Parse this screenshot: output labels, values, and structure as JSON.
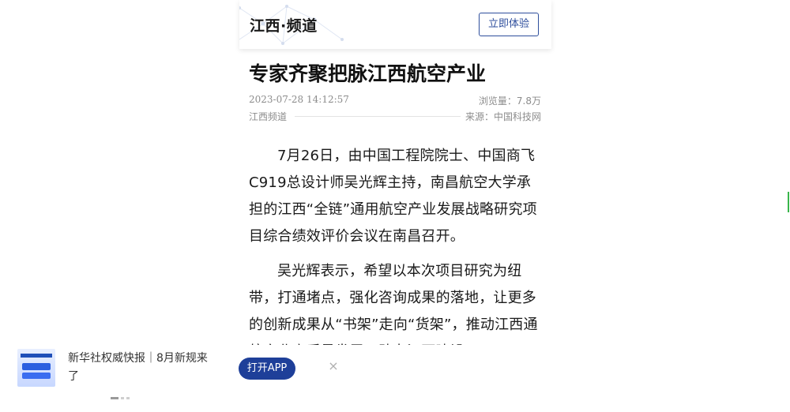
{
  "header": {
    "channel_name": "江西·频道",
    "try_button": "立即体验"
  },
  "article": {
    "title": "专家齐聚把脉江西航空产业",
    "date": "2023-07-28 14:12:57",
    "views": "浏览量：7.8万",
    "channel": "江西频道",
    "source": "来源：中国科技网",
    "paragraphs": [
      "7月26日，由中国工程院院士、中国商飞C919总设计师吴光辉主持，南昌航空大学承担的江西“全链”通用航空产业发展战略研究项目综合绩效评价会议在南昌召开。",
      "吴光辉表示，希望以本次项目研究为纽带，打通堵点，强化咨询成果的落地，让更多的创新成果从“书架”走向“货架”，推动江西通航产业高质量发展，助力江西建设"
    ]
  },
  "ad": {
    "text": "新华社权威快报｜8月新规来了",
    "open_app_button": "打开APP",
    "close_icon": "×"
  },
  "carousel": {
    "total": 3,
    "active_index": 0
  },
  "colors": {
    "brand_blue": "#1e3f99",
    "button_outline": "#2e4e9c"
  }
}
